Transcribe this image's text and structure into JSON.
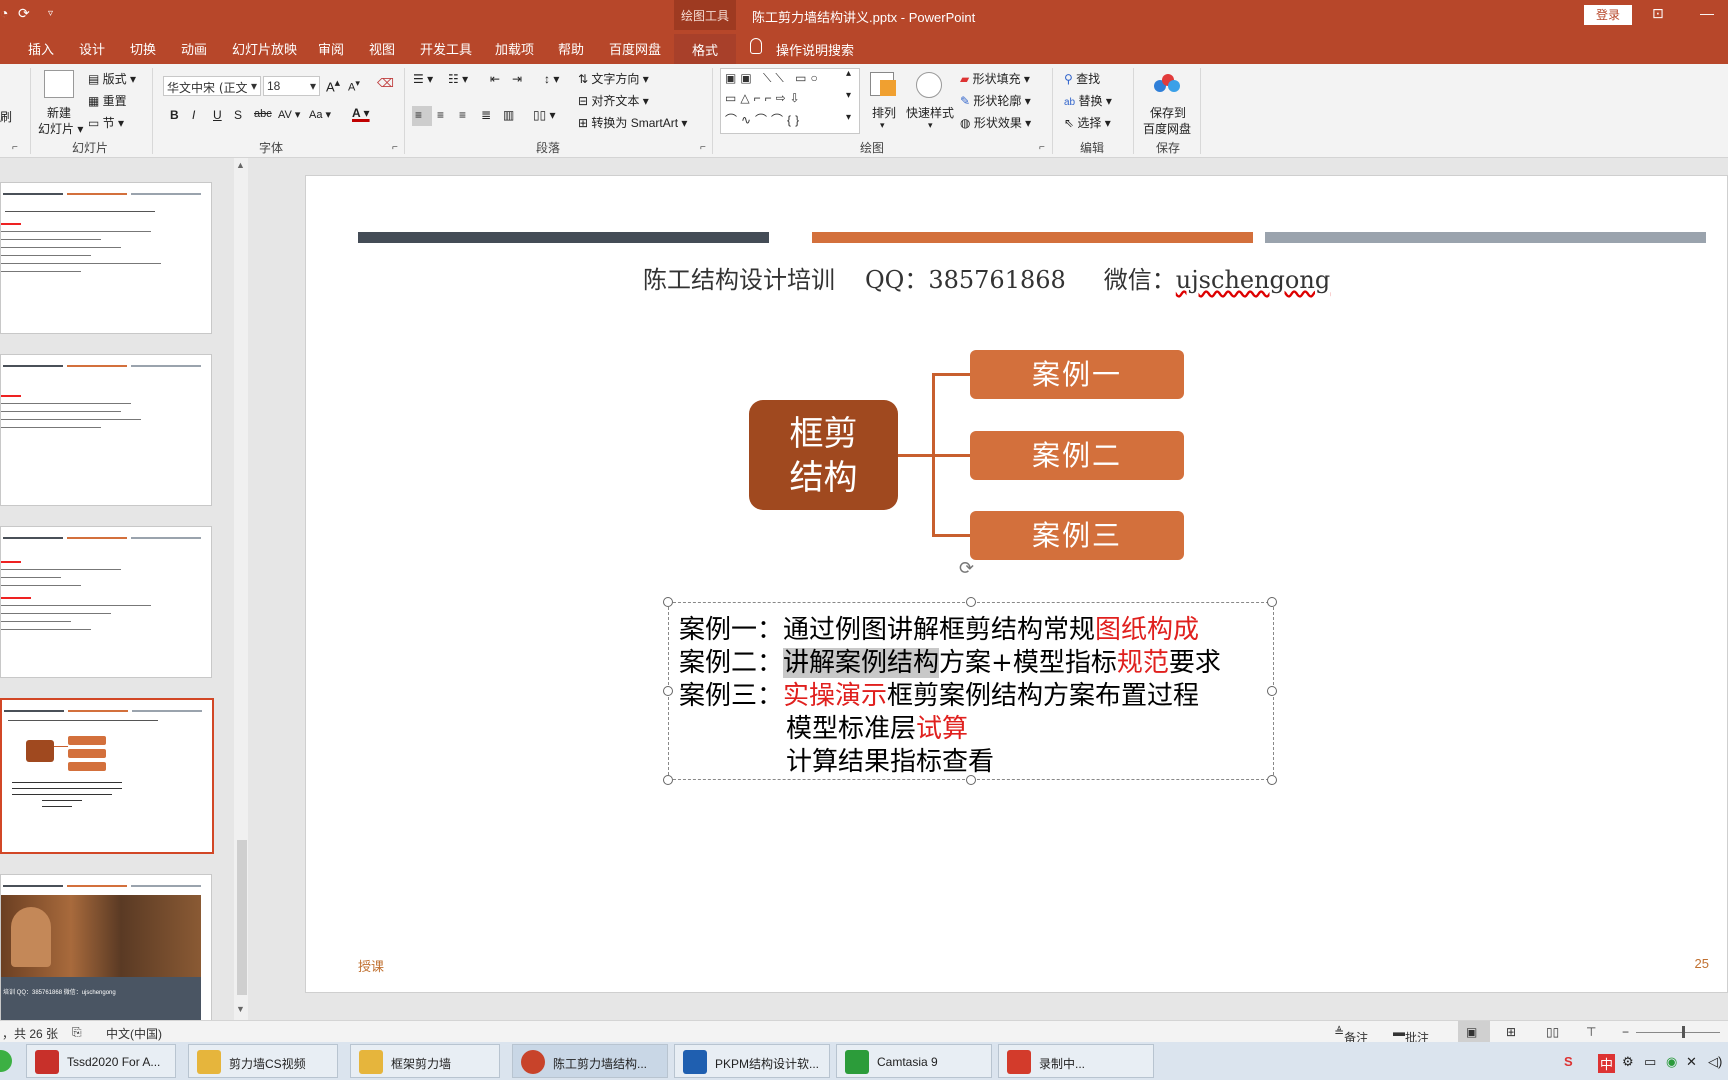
{
  "titlebar": {
    "context_group": "绘图工具",
    "document_title": "陈工剪力墙结构讲义.pptx  -  PowerPoint",
    "login": "登录"
  },
  "tabs": [
    "插入",
    "设计",
    "切换",
    "动画",
    "幻灯片放映",
    "审阅",
    "视图",
    "开发工具",
    "加载项",
    "帮助",
    "百度网盘"
  ],
  "active_tab": "格式",
  "search_hint": "操作说明搜索",
  "ribbon": {
    "slides": {
      "new_slide": "新建\n幻灯片",
      "layout": "版式",
      "reset": "重置",
      "section": "节",
      "label": "幻灯片"
    },
    "font": {
      "name": "华文中宋 (正文",
      "size": "18",
      "label": "字体"
    },
    "paragraph": {
      "text_direction": "文字方向",
      "align_text": "对齐文本",
      "smartart": "转换为 SmartArt",
      "label": "段落"
    },
    "drawing": {
      "arrange": "排列",
      "quick_styles": "快速样式",
      "shape_fill": "形状填充",
      "shape_outline": "形状轮廓",
      "shape_effects": "形状效果",
      "label": "绘图"
    },
    "editing": {
      "find": "查找",
      "replace": "替换",
      "select": "选择",
      "label": "编辑"
    },
    "save": {
      "save_to_baidu": "保存到\n百度网盘",
      "label": "保存"
    },
    "left_edge": "刷"
  },
  "thumb_texts": {
    "t4_footer": "培训   QQ：385761868     微信：ujschengong"
  },
  "slide": {
    "headline": {
      "part1": "陈工结构设计培训",
      "part2": "QQ：385761868",
      "part3_label": "微信：",
      "part3_value": "ujschengong"
    },
    "core_box": [
      "框剪",
      "结构"
    ],
    "cases": [
      "案例一",
      "案例二",
      "案例三"
    ],
    "text_lines": {
      "l1_label": "案例一：",
      "l1_text": "通过例图讲解框剪结构常规",
      "l1_red": "图纸构成",
      "l2_label": "案例二：",
      "l2_hl": "讲解案例结构",
      "l2_text": "方案+模型指标",
      "l2_red": "规范",
      "l2_tail": "要求",
      "l3_label": "案例三：",
      "l3_red": "实操演示",
      "l3_text": "框剪案例结构方案布置过程",
      "l4_text": "模型标准层",
      "l4_red": "试算",
      "l5_text": "计算结果指标查看"
    },
    "footer_left": "授课",
    "page_number": "25"
  },
  "statusbar": {
    "slide_count": "，共 26 张",
    "language": "中文(中国)",
    "notes": "备注",
    "comments": "批注"
  },
  "taskbar": [
    {
      "label": "Tssd2020 For A...",
      "color": "#c8302a"
    },
    {
      "label": "剪力墙CS视频",
      "color": "#e6b53c"
    },
    {
      "label": "框架剪力墙",
      "color": "#e6b53c"
    },
    {
      "label": "陈工剪力墙结构...",
      "color": "#c8432a"
    },
    {
      "label": "PKPM结构设计软...",
      "color": "#1f5fb0"
    },
    {
      "label": "Camtasia 9",
      "color": "#2c9c3a"
    },
    {
      "label": "录制中...",
      "color": "#d33b2b"
    }
  ],
  "tray": {
    "ime": "中"
  }
}
